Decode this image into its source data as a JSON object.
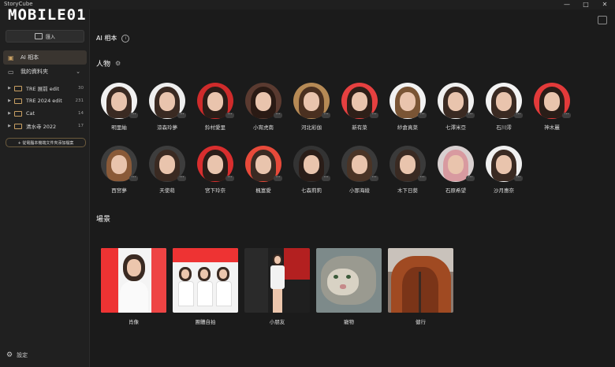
{
  "app": {
    "name": "StoryCube",
    "logo_text": "MOBILE01"
  },
  "window_controls": [
    "—",
    "□",
    "✕"
  ],
  "sidebar": {
    "import_label": "匯入",
    "nav": [
      {
        "label": "AI 相本",
        "icon": "album-icon",
        "active": true
      },
      {
        "label": "我的資料夾",
        "icon": "folder-icon",
        "active": false
      }
    ],
    "folders": [
      {
        "name": "TRE 展前 edit",
        "count": "30"
      },
      {
        "name": "TRE 2024 edit",
        "count": "231"
      },
      {
        "name": "Cat",
        "count": "14"
      },
      {
        "name": "清水寺 2022",
        "count": "17"
      }
    ],
    "add_folder_label": "+ 從電腦本機端文件夾添加檔案",
    "settings_label": "設定"
  },
  "main": {
    "title": "AI 相本",
    "people_title": "人物",
    "scenes_title": "場景",
    "people": [
      {
        "name": "明里紬",
        "bg": "#f1f1f1",
        "hair": "#3a2a22"
      },
      {
        "name": "涼森玲夢",
        "bg": "#eeeeee",
        "hair": "#3a2a22"
      },
      {
        "name": "鈴村愛里",
        "bg": "#cf2b2b",
        "hair": "#2a1d18"
      },
      {
        "name": "小宵虎南",
        "bg": "#5a3a30",
        "hair": "#2a1a14"
      },
      {
        "name": "河北彩伽",
        "bg": "#b68a55",
        "hair": "#4a3020"
      },
      {
        "name": "新有菜",
        "bg": "#e64040",
        "hair": "#2e1f18"
      },
      {
        "name": "紗倉真菜",
        "bg": "#f2f2f2",
        "hair": "#7a5535"
      },
      {
        "name": "七澤米亞",
        "bg": "#f0f0f0",
        "hair": "#3a2a22"
      },
      {
        "name": "石川澪",
        "bg": "#f3f3f3",
        "hair": "#3a2a22"
      },
      {
        "name": "神木麗",
        "bg": "#e33a3a",
        "hair": "#2a1d18"
      },
      {
        "name": "西宮夢",
        "bg": "#3d3d3d",
        "hair": "#8a5a38"
      },
      {
        "name": "天使萌",
        "bg": "#3d3d3d",
        "hair": "#3a2a22"
      },
      {
        "name": "宮下玲奈",
        "bg": "#d92e2e",
        "hair": "#2a1d18"
      },
      {
        "name": "楓富愛",
        "bg": "#e84a3a",
        "hair": "#3a2a22"
      },
      {
        "name": "七森莉莉",
        "bg": "#333333",
        "hair": "#2a1d18"
      },
      {
        "name": "小那海綾",
        "bg": "#3a3a3a",
        "hair": "#4a3426"
      },
      {
        "name": "木下日葵",
        "bg": "#3a3a3a",
        "hair": "#3a2a22"
      },
      {
        "name": "石原希望",
        "bg": "#d8d0d0",
        "hair": "#d89aa0"
      },
      {
        "name": "沙月惠奈",
        "bg": "#f0f0f0",
        "hair": "#3a2a22"
      }
    ],
    "scenes": [
      {
        "name": "肖像"
      },
      {
        "name": "團體自拍"
      },
      {
        "name": "小朋友"
      },
      {
        "name": "寵物"
      },
      {
        "name": "健行"
      }
    ]
  }
}
